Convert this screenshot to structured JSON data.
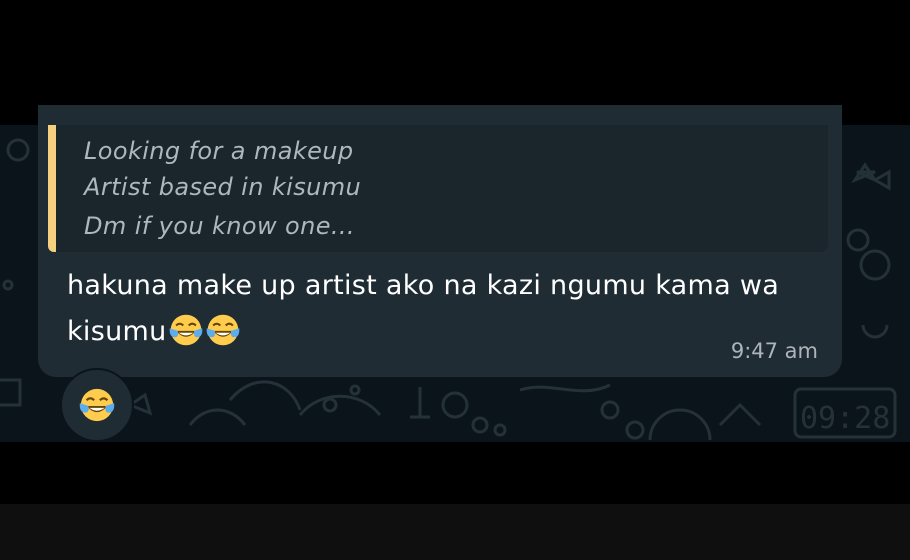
{
  "quoted_message": {
    "lines": [
      "Looking for a makeup",
      "Artist based in kisumu",
      "Dm if you know one..."
    ],
    "accent_color": "#f5d17f"
  },
  "message": {
    "line1": "hakuna make up artist ako na kazi ngumu kama wa",
    "line2": "kisumu",
    "emojis": [
      "face-with-tears-of-joy",
      "face-with-tears-of-joy"
    ],
    "time": "9:47 am"
  },
  "reaction": {
    "emoji": "face-with-tears-of-joy"
  },
  "colors": {
    "chat_background": "#0b141a",
    "bubble": "#1f2c34",
    "text": "#ffffff",
    "secondary_text": "#aeb5ba"
  }
}
